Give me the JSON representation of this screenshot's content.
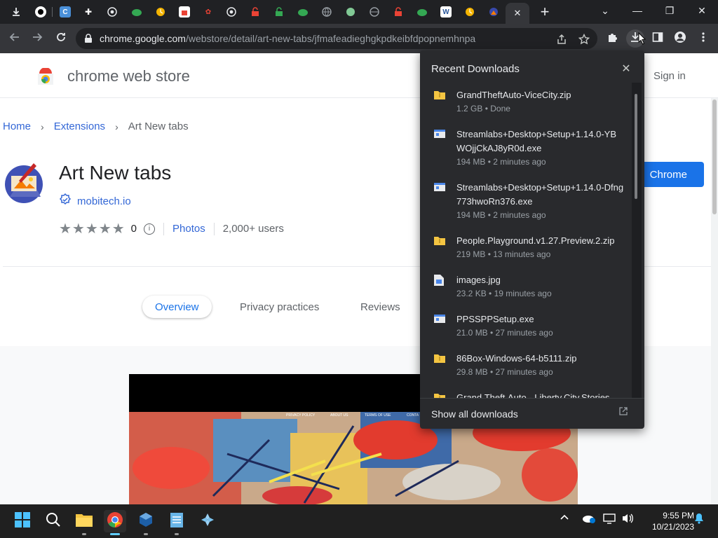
{
  "browser": {
    "active_tab_close": "✕",
    "new_tab": "+",
    "url_host": "chrome.google.com",
    "url_path": "/webstore/detail/art-new-tabs/jfmafeadieghgkpdkeibfdpopnemhnpa"
  },
  "store": {
    "title": "chrome web store",
    "sign_in": "Sign in",
    "breadcrumbs": [
      "Home",
      "Extensions",
      "Art New tabs"
    ],
    "extension_name": "Art New tabs",
    "developer": "mobitech.io",
    "rating_count": "0",
    "photos_link": "Photos",
    "users": "2,000+ users",
    "add_button": "Chrome",
    "tabs": [
      "Overview",
      "Privacy practices",
      "Reviews"
    ],
    "screenshot_nav": [
      "PRIVACY POLICY",
      "ABOUT US",
      "TERMS OF USE",
      "CONTA"
    ]
  },
  "downloads": {
    "title": "Recent Downloads",
    "items": [
      {
        "name": "GrandTheftAuto-ViceCity.zip",
        "meta": "1.2 GB • Done",
        "type": "zip"
      },
      {
        "name": "Streamlabs+Desktop+Setup+1.14.0-YBWOjjCkAJ8yR0d.exe",
        "meta": "194 MB • 2 minutes ago",
        "type": "exe"
      },
      {
        "name": "Streamlabs+Desktop+Setup+1.14.0-Dfng773hwoRn376.exe",
        "meta": "194 MB • 2 minutes ago",
        "type": "exe"
      },
      {
        "name": "People.Playground.v1.27.Preview.2.zip",
        "meta": "219 MB • 13 minutes ago",
        "type": "zip"
      },
      {
        "name": "images.jpg",
        "meta": "23.2 KB • 19 minutes ago",
        "type": "jpg"
      },
      {
        "name": "PPSSPPSetup.exe",
        "meta": "21.0 MB • 27 minutes ago",
        "type": "exe"
      },
      {
        "name": "86Box-Windows-64-b5111.zip",
        "meta": "29.8 MB • 27 minutes ago",
        "type": "zip"
      },
      {
        "name": "Grand.Theft.Auto.-.Liberty.City.Stories",
        "meta": "",
        "type": "zip"
      }
    ],
    "show_all": "Show all downloads"
  },
  "taskbar": {
    "time": "9:55 PM",
    "date": "10/21/2023"
  },
  "colors": {
    "accent": "#1a73e8",
    "link": "#3367d6",
    "dark_bg": "#202124",
    "toolbar_bg": "#35363a"
  }
}
